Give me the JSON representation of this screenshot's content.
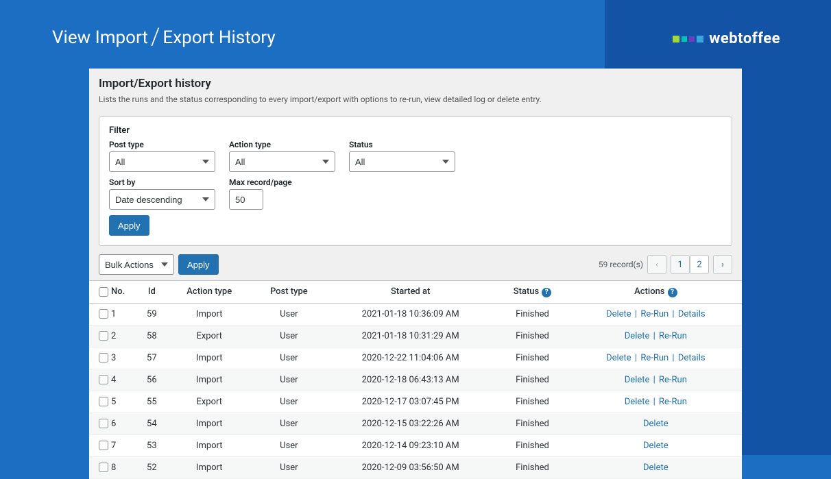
{
  "outer_header": {
    "part1": "View Import",
    "part2": "Export History"
  },
  "logo_text": "webtoffee",
  "panel": {
    "title": "Import/Export history",
    "description": "Lists the runs and the status corresponding to every import/export with options to re-run, view detailed log or delete entry."
  },
  "filter": {
    "title": "Filter",
    "post_type_label": "Post type",
    "post_type_value": "All",
    "action_type_label": "Action type",
    "action_type_value": "All",
    "status_label": "Status",
    "status_value": "All",
    "sort_by_label": "Sort by",
    "sort_by_value": "Date descending",
    "max_record_label": "Max record/page",
    "max_record_value": "50",
    "apply_label": "Apply"
  },
  "bulk": {
    "select_label": "Bulk Actions",
    "apply_label": "Apply"
  },
  "pagination": {
    "record_text": "59 record(s)",
    "prev": "‹",
    "pages": [
      "1",
      "2"
    ],
    "next": "›",
    "active": "2"
  },
  "table": {
    "headers": {
      "no": "No.",
      "id": "Id",
      "action_type": "Action type",
      "post_type": "Post type",
      "started_at": "Started at",
      "status": "Status",
      "actions": "Actions"
    },
    "help_glyph": "?",
    "action_labels": {
      "delete": "Delete",
      "rerun": "Re-Run",
      "details": "Details",
      "sep": "|"
    },
    "rows": [
      {
        "no": "1",
        "id": "59",
        "action_type": "Import",
        "post_type": "User",
        "started_at": "2021-01-18 10:36:09 AM",
        "status": "Finished",
        "actions": [
          "delete",
          "rerun",
          "details"
        ]
      },
      {
        "no": "2",
        "id": "58",
        "action_type": "Export",
        "post_type": "User",
        "started_at": "2021-01-18 10:31:29 AM",
        "status": "Finished",
        "actions": [
          "delete",
          "rerun"
        ]
      },
      {
        "no": "3",
        "id": "57",
        "action_type": "Import",
        "post_type": "User",
        "started_at": "2020-12-22 11:04:06 AM",
        "status": "Finished",
        "actions": [
          "delete",
          "rerun",
          "details"
        ]
      },
      {
        "no": "4",
        "id": "56",
        "action_type": "Import",
        "post_type": "User",
        "started_at": "2020-12-18 06:43:13 AM",
        "status": "Finished",
        "actions": [
          "delete",
          "rerun"
        ]
      },
      {
        "no": "5",
        "id": "55",
        "action_type": "Export",
        "post_type": "User",
        "started_at": "2020-12-17 03:07:45 PM",
        "status": "Finished",
        "actions": [
          "delete",
          "rerun"
        ]
      },
      {
        "no": "6",
        "id": "54",
        "action_type": "Import",
        "post_type": "User",
        "started_at": "2020-12-15 03:22:26 AM",
        "status": "Finished",
        "actions": [
          "delete"
        ]
      },
      {
        "no": "7",
        "id": "53",
        "action_type": "Import",
        "post_type": "User",
        "started_at": "2020-12-14 09:23:10 AM",
        "status": "Finished",
        "actions": [
          "delete"
        ]
      },
      {
        "no": "8",
        "id": "52",
        "action_type": "Import",
        "post_type": "User",
        "started_at": "2020-12-09 03:56:50 AM",
        "status": "Finished",
        "actions": [
          "delete"
        ]
      }
    ]
  }
}
